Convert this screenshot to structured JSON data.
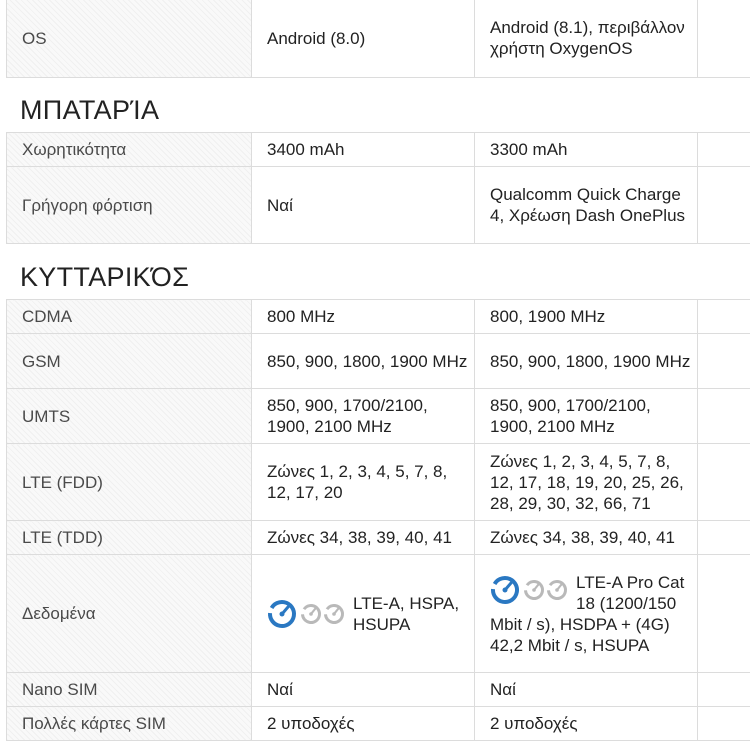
{
  "os": {
    "label": "OS",
    "phone1": "Android (8.0)",
    "phone2": "Android (8.1), περιβάλλον χρήστη OxygenOS"
  },
  "battery": {
    "title": "ΜΠΑΤΑΡΊΑ",
    "rows": [
      {
        "label": "Χωρητικότητα",
        "phone1": "3400 mAh",
        "phone2": "3300 mAh"
      },
      {
        "label": "Γρήγορη φόρτιση",
        "phone1": "Ναί",
        "phone2": "Qualcomm Quick Charge 4, Χρέωση Dash OnePlus"
      }
    ]
  },
  "cellular": {
    "title": "ΚΥΤΤΑΡΙΚΌΣ",
    "rows": [
      {
        "label": "CDMA",
        "phone1": "800 MHz",
        "phone2": "800, 1900 MHz"
      },
      {
        "label": "GSM",
        "phone1": "850, 900, 1800, 1900 MHz",
        "phone2": "850, 900, 1800, 1900 MHz"
      },
      {
        "label": "UMTS",
        "phone1": "850, 900, 1700/2100, 1900, 2100 MHz",
        "phone2": "850, 900, 1700/2100, 1900, 2100 MHz"
      },
      {
        "label": "LTE (FDD)",
        "phone1": "Ζώνες 1, 2, 3, 4, 5, 7, 8, 12, 17, 20",
        "phone2": "Ζώνες 1, 2, 3, 4, 5, 7, 8, 12, 17, 18, 19, 20, 25, 26, 28, 29, 30, 32, 66, 71"
      },
      {
        "label": "LTE (TDD)",
        "phone1": "Ζώνες 34, 38, 39, 40, 41",
        "phone2": "Ζώνες 34, 38, 39, 40, 41"
      },
      {
        "label": "Δεδομένα",
        "phone1": "LTE-A, HSPA, HSUPA",
        "phone2": "LTE-A Pro Cat 18 (1200/150 Mbit / s), HSDPA + (4G) 42,2 Mbit / s, HSUPA"
      },
      {
        "label": "Nano SIM",
        "phone1": "Ναί",
        "phone2": "Ναί"
      },
      {
        "label": "Πολλές κάρτες SIM",
        "phone1": "2 υποδοχές",
        "phone2": "2 υποδοχές"
      }
    ]
  },
  "colors": {
    "gauge_active": "#2a78c2",
    "gauge_inactive": "#b9b9b9",
    "border": "#dcdcdc"
  },
  "icons": {
    "data_speed": "speed-gauge-icon"
  }
}
